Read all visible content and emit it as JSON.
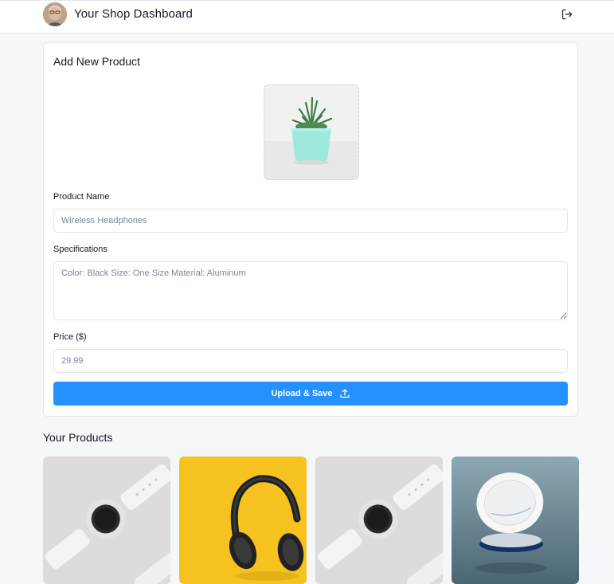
{
  "header": {
    "title": "Your Shop Dashboard",
    "avatar_icon": "user-avatar",
    "logout_icon": "logout-icon"
  },
  "form": {
    "title": "Add New Product",
    "image_preview_icon": "potted-succulent-image",
    "name_label": "Product Name",
    "name_placeholder": "Wireless Headphones",
    "specs_label": "Specifications",
    "specs_placeholder": "Color: Black Size: One Size Material: Aluminum",
    "price_label": "Price ($)",
    "price_placeholder": "29.99",
    "submit_label": "Upload & Save",
    "submit_icon": "upload-icon"
  },
  "products": {
    "title": "Your Products",
    "items": [
      {
        "image": "smartwatch-white-image"
      },
      {
        "image": "headphones-on-yellow-image"
      },
      {
        "image": "smartwatch-white-image"
      },
      {
        "image": "dove-cream-jar-image"
      }
    ]
  },
  "colors": {
    "accent": "#2491ff",
    "background": "#f6f7f9",
    "card": "#ffffff",
    "border": "#e5e7eb"
  }
}
